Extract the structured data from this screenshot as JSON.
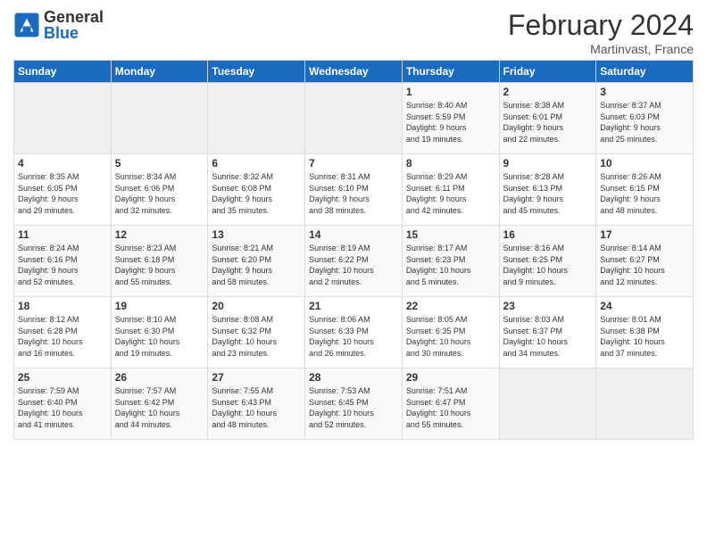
{
  "logo": {
    "general": "General",
    "blue": "Blue"
  },
  "header": {
    "title": "February 2024",
    "subtitle": "Martinvast, France"
  },
  "days_of_week": [
    "Sunday",
    "Monday",
    "Tuesday",
    "Wednesday",
    "Thursday",
    "Friday",
    "Saturday"
  ],
  "weeks": [
    [
      {
        "day": "",
        "info": ""
      },
      {
        "day": "",
        "info": ""
      },
      {
        "day": "",
        "info": ""
      },
      {
        "day": "",
        "info": ""
      },
      {
        "day": "1",
        "info": "Sunrise: 8:40 AM\nSunset: 5:59 PM\nDaylight: 9 hours\nand 19 minutes."
      },
      {
        "day": "2",
        "info": "Sunrise: 8:38 AM\nSunset: 6:01 PM\nDaylight: 9 hours\nand 22 minutes."
      },
      {
        "day": "3",
        "info": "Sunrise: 8:37 AM\nSunset: 6:03 PM\nDaylight: 9 hours\nand 25 minutes."
      }
    ],
    [
      {
        "day": "4",
        "info": "Sunrise: 8:35 AM\nSunset: 6:05 PM\nDaylight: 9 hours\nand 29 minutes."
      },
      {
        "day": "5",
        "info": "Sunrise: 8:34 AM\nSunset: 6:06 PM\nDaylight: 9 hours\nand 32 minutes."
      },
      {
        "day": "6",
        "info": "Sunrise: 8:32 AM\nSunset: 6:08 PM\nDaylight: 9 hours\nand 35 minutes."
      },
      {
        "day": "7",
        "info": "Sunrise: 8:31 AM\nSunset: 6:10 PM\nDaylight: 9 hours\nand 38 minutes."
      },
      {
        "day": "8",
        "info": "Sunrise: 8:29 AM\nSunset: 6:11 PM\nDaylight: 9 hours\nand 42 minutes."
      },
      {
        "day": "9",
        "info": "Sunrise: 8:28 AM\nSunset: 6:13 PM\nDaylight: 9 hours\nand 45 minutes."
      },
      {
        "day": "10",
        "info": "Sunrise: 8:26 AM\nSunset: 6:15 PM\nDaylight: 9 hours\nand 48 minutes."
      }
    ],
    [
      {
        "day": "11",
        "info": "Sunrise: 8:24 AM\nSunset: 6:16 PM\nDaylight: 9 hours\nand 52 minutes."
      },
      {
        "day": "12",
        "info": "Sunrise: 8:23 AM\nSunset: 6:18 PM\nDaylight: 9 hours\nand 55 minutes."
      },
      {
        "day": "13",
        "info": "Sunrise: 8:21 AM\nSunset: 6:20 PM\nDaylight: 9 hours\nand 58 minutes."
      },
      {
        "day": "14",
        "info": "Sunrise: 8:19 AM\nSunset: 6:22 PM\nDaylight: 10 hours\nand 2 minutes."
      },
      {
        "day": "15",
        "info": "Sunrise: 8:17 AM\nSunset: 6:23 PM\nDaylight: 10 hours\nand 5 minutes."
      },
      {
        "day": "16",
        "info": "Sunrise: 8:16 AM\nSunset: 6:25 PM\nDaylight: 10 hours\nand 9 minutes."
      },
      {
        "day": "17",
        "info": "Sunrise: 8:14 AM\nSunset: 6:27 PM\nDaylight: 10 hours\nand 12 minutes."
      }
    ],
    [
      {
        "day": "18",
        "info": "Sunrise: 8:12 AM\nSunset: 6:28 PM\nDaylight: 10 hours\nand 16 minutes."
      },
      {
        "day": "19",
        "info": "Sunrise: 8:10 AM\nSunset: 6:30 PM\nDaylight: 10 hours\nand 19 minutes."
      },
      {
        "day": "20",
        "info": "Sunrise: 8:08 AM\nSunset: 6:32 PM\nDaylight: 10 hours\nand 23 minutes."
      },
      {
        "day": "21",
        "info": "Sunrise: 8:06 AM\nSunset: 6:33 PM\nDaylight: 10 hours\nand 26 minutes."
      },
      {
        "day": "22",
        "info": "Sunrise: 8:05 AM\nSunset: 6:35 PM\nDaylight: 10 hours\nand 30 minutes."
      },
      {
        "day": "23",
        "info": "Sunrise: 8:03 AM\nSunset: 6:37 PM\nDaylight: 10 hours\nand 34 minutes."
      },
      {
        "day": "24",
        "info": "Sunrise: 8:01 AM\nSunset: 6:38 PM\nDaylight: 10 hours\nand 37 minutes."
      }
    ],
    [
      {
        "day": "25",
        "info": "Sunrise: 7:59 AM\nSunset: 6:40 PM\nDaylight: 10 hours\nand 41 minutes."
      },
      {
        "day": "26",
        "info": "Sunrise: 7:57 AM\nSunset: 6:42 PM\nDaylight: 10 hours\nand 44 minutes."
      },
      {
        "day": "27",
        "info": "Sunrise: 7:55 AM\nSunset: 6:43 PM\nDaylight: 10 hours\nand 48 minutes."
      },
      {
        "day": "28",
        "info": "Sunrise: 7:53 AM\nSunset: 6:45 PM\nDaylight: 10 hours\nand 52 minutes."
      },
      {
        "day": "29",
        "info": "Sunrise: 7:51 AM\nSunset: 6:47 PM\nDaylight: 10 hours\nand 55 minutes."
      },
      {
        "day": "",
        "info": ""
      },
      {
        "day": "",
        "info": ""
      }
    ]
  ]
}
